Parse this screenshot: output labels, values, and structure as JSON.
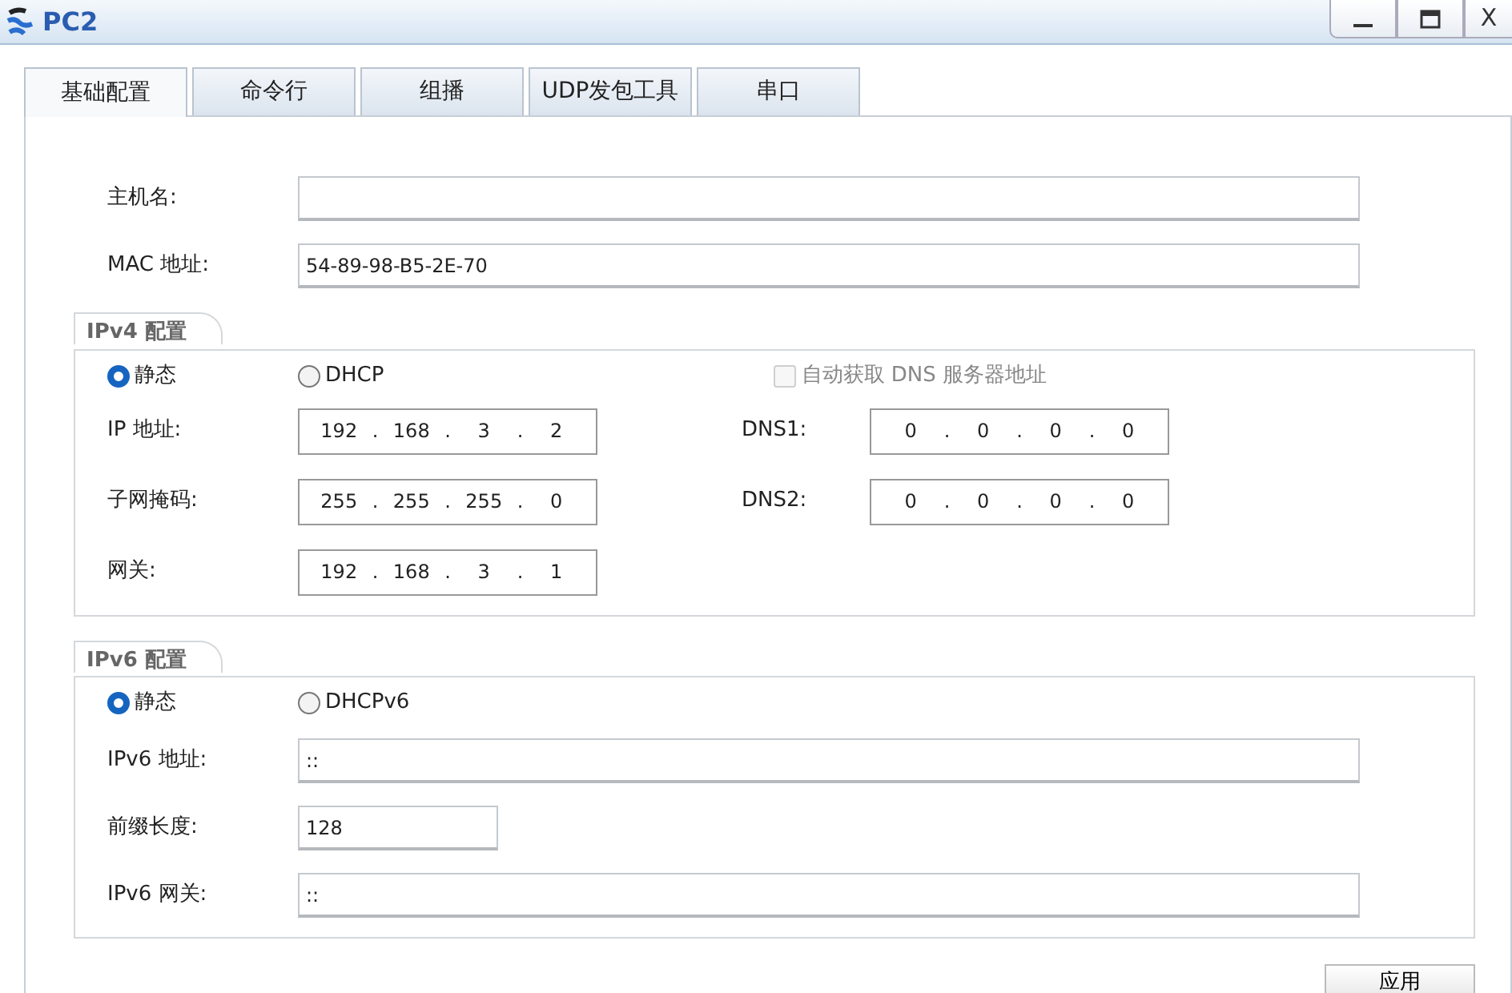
{
  "window": {
    "title": "PC2",
    "close_label": "X"
  },
  "tabs": [
    {
      "label": "基础配置",
      "selected": true
    },
    {
      "label": "命令行",
      "selected": false
    },
    {
      "label": "组播",
      "selected": false
    },
    {
      "label": "UDP发包工具",
      "selected": false
    },
    {
      "label": "串口",
      "selected": false
    }
  ],
  "host": {
    "hostname_label": "主机名:",
    "mac_label": "MAC 地址:",
    "mac_value": "54-89-98-B5-2E-70"
  },
  "ipv4": {
    "title": "IPv4 配置",
    "modes": [
      {
        "label": "静态",
        "selected": true
      },
      {
        "label": "DHCP",
        "selected": false
      }
    ],
    "auto_dns": {
      "label": "自动获取 DNS 服务器地址",
      "checked": false,
      "disabled": true
    },
    "fields": [
      {
        "label": "IP 地址:",
        "parts": [
          "192",
          ".",
          "168",
          ".",
          "3",
          ".",
          "2"
        ]
      },
      {
        "label": "子网掩码:",
        "parts": [
          "255",
          ".",
          "255",
          ".",
          "255",
          ".",
          "0"
        ]
      },
      {
        "label": "网关:",
        "parts": [
          "192",
          ".",
          "168",
          ".",
          "3",
          ".",
          "1"
        ]
      }
    ],
    "dns": [
      {
        "label": "DNS1:",
        "parts": [
          "0",
          ".",
          "0",
          ".",
          "0",
          ".",
          "0"
        ]
      },
      {
        "label": "DNS2:",
        "parts": [
          "0",
          ".",
          "0",
          ".",
          "0",
          ".",
          "0"
        ]
      }
    ]
  },
  "ipv6": {
    "title": "IPv6 配置",
    "modes": [
      {
        "label": "静态",
        "selected": true
      },
      {
        "label": "DHCPv6",
        "selected": false
      }
    ],
    "fields": [
      {
        "label": "IPv6 地址:",
        "value": "::",
        "kind": "wide"
      },
      {
        "label": "前缀长度:",
        "value": "128",
        "kind": "short"
      },
      {
        "label": "IPv6 网关:",
        "value": "::",
        "kind": "wide"
      }
    ]
  },
  "apply_button": "应用"
}
